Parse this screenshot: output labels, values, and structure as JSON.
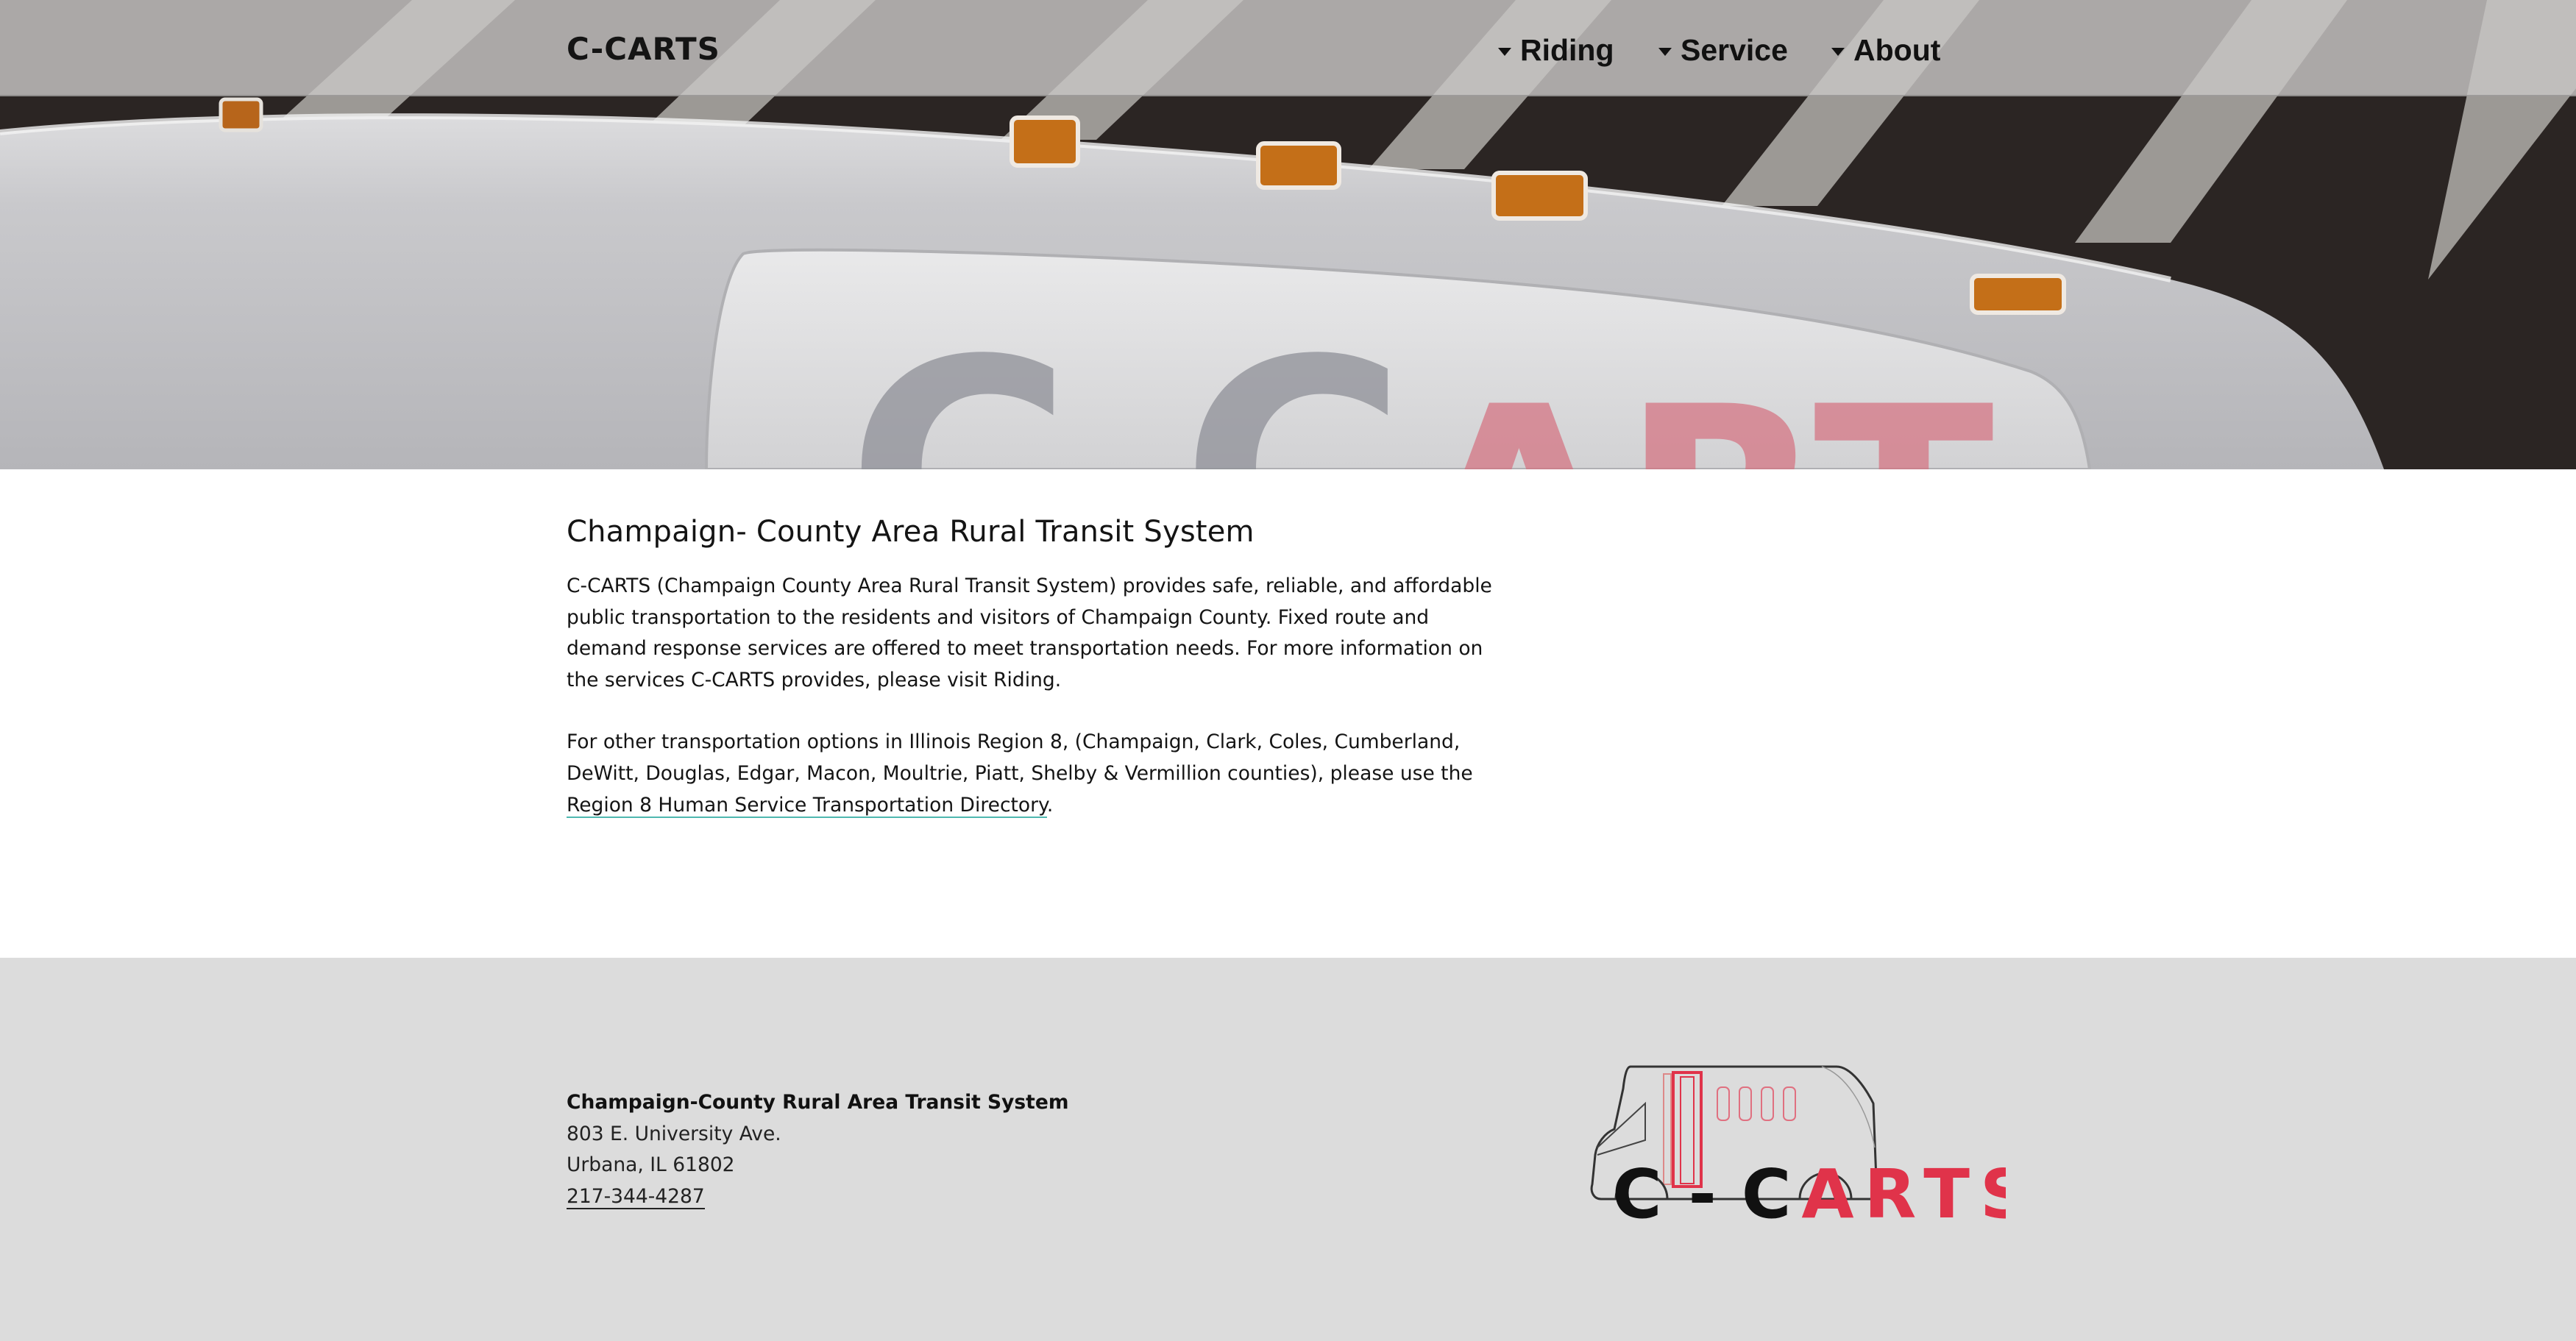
{
  "header": {
    "brand": "C-CARTS",
    "nav": [
      {
        "label": "Riding"
      },
      {
        "label": "Service"
      },
      {
        "label": "About"
      }
    ]
  },
  "hero": {
    "bus_lettering": "C-CARTS"
  },
  "main": {
    "title": "Champaign- County Area Rural Transit System",
    "intro": "C-CARTS (Champaign County Area Rural Transit System) provides safe, reliable, and affordable public transportation to the residents and visitors of Champaign County. Fixed route and demand response services are offered to meet transportation needs. For more information on the services C-CARTS provides, please visit Riding.",
    "region_text": "For other transportation options in Illinois Region 8, (Champaign, Clark, Coles, Cumberland, DeWitt, Douglas, Edgar, Macon, Moultrie, Piatt, Shelby & Vermillion counties), please use the ",
    "region_link": "Region 8 Human Service Transportation Directory",
    "region_end": "."
  },
  "footer": {
    "org_name": "Champaign-County Rural Area Transit System",
    "street": "803 E. University Ave.",
    "city": "Urbana, IL 61802",
    "phone": "217-344-4287",
    "logo_text": "C - CARTS"
  },
  "colors": {
    "accent_red": "#e0334a",
    "link_underline": "#4fb8b0",
    "footer_bg": "#dcdcdc"
  }
}
